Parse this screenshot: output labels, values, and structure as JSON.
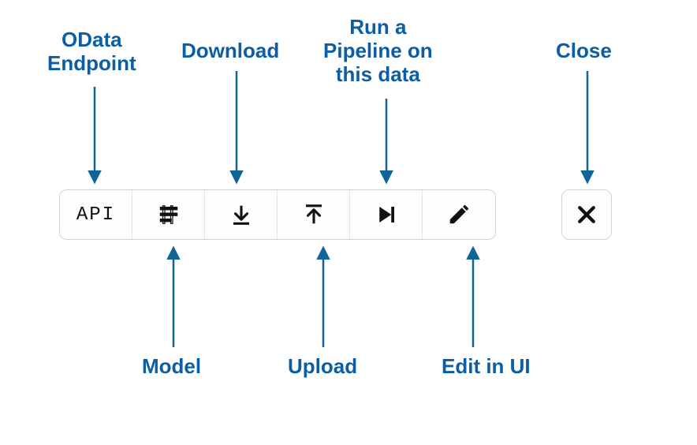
{
  "annotations": {
    "top": {
      "odata": "OData\nEndpoint",
      "download": "Download",
      "run": "Run a\nPipeline on\nthis data",
      "close": "Close"
    },
    "bottom": {
      "model": "Model",
      "upload": "Upload",
      "edit": "Edit in UI"
    }
  },
  "toolbar": {
    "api_label": "API",
    "buttons": [
      {
        "name": "api-button",
        "icon": "api-text",
        "tooltip": "OData Endpoint"
      },
      {
        "name": "model-button",
        "icon": "model-icon",
        "tooltip": "Model"
      },
      {
        "name": "download-button",
        "icon": "download-icon",
        "tooltip": "Download"
      },
      {
        "name": "upload-button",
        "icon": "upload-icon",
        "tooltip": "Upload"
      },
      {
        "name": "run-button",
        "icon": "play-next-icon",
        "tooltip": "Run a Pipeline on this data"
      },
      {
        "name": "edit-button",
        "icon": "pencil-icon",
        "tooltip": "Edit in UI"
      }
    ],
    "close": {
      "name": "close-button",
      "icon": "close-icon",
      "tooltip": "Close"
    }
  },
  "colors": {
    "label": "#0b5ea3",
    "arrow": "#0f6596",
    "icon": "#111111",
    "border": "#cfd4d9"
  }
}
